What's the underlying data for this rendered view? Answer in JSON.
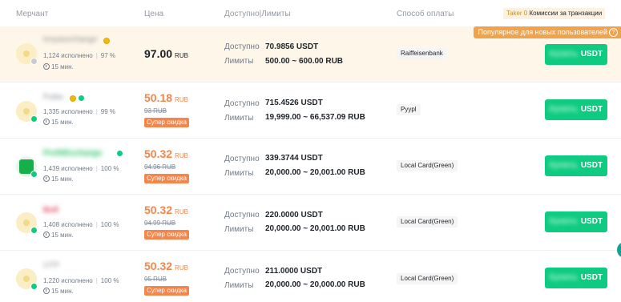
{
  "header": {
    "merchant": "Мерчант",
    "price": "Цена",
    "limits": "Доступно|Лимиты",
    "payment": "Способ оплаты",
    "taker_prefix": "Taker 0",
    "taker_suffix": "Комиссии за транзакции"
  },
  "popular_label": "Популярное для новых пользователей",
  "popular_help": "?",
  "labels": {
    "available": "Доступно",
    "limits": "Лимиты"
  },
  "rows": [
    {
      "merchant": "lonyasochange",
      "stats": "1,124 исполнено",
      "completion": "97 %",
      "time": "15 мин.",
      "price": "97.00",
      "currency": "RUB",
      "old_price": "",
      "discount": "",
      "available": "70.9856 USDT",
      "limits": "500.00 ~ 600.00 RUB",
      "payment": "Raiffeisenbank",
      "buy_hidden": "Купить",
      "buy_asset": "USDT"
    },
    {
      "merchant": "Pubis",
      "stats": "1,335 исполнено",
      "completion": "99 %",
      "time": "15 мин.",
      "price": "50.18",
      "currency": "RUB",
      "old_price": "93 RUB",
      "discount": "Супер скидка",
      "available": "715.4526 USDT",
      "limits": "19,999.00 ~ 66,537.09 RUB",
      "payment": "Pyypl",
      "buy_hidden": "Купить",
      "buy_asset": "USDT"
    },
    {
      "merchant": "ProfitExchange",
      "stats": "1,439 исполнено",
      "completion": "100 %",
      "time": "15 мин.",
      "price": "50.32",
      "currency": "RUB",
      "old_price": "94.96 RUB",
      "discount": "Супер скидка",
      "available": "339.3744 USDT",
      "limits": "20,000.00 ~ 20,001.00 RUB",
      "payment": "Local Card(Green)",
      "buy_hidden": "Купить",
      "buy_asset": "USDT"
    },
    {
      "merchant": "Bull",
      "stats": "1,408 исполнено",
      "completion": "100 %",
      "time": "15 мин.",
      "price": "50.32",
      "currency": "RUB",
      "old_price": "94.99 RUB",
      "discount": "Супер скидка",
      "available": "220.0000 USDT",
      "limits": "20,000.00 ~ 20,001.00 RUB",
      "payment": "Local Card(Green)",
      "buy_hidden": "Купить",
      "buy_asset": "USDT"
    },
    {
      "merchant": "UTP",
      "stats": "1,220 исполнено",
      "completion": "100 %",
      "time": "15 мин.",
      "price": "50.32",
      "currency": "RUB",
      "old_price": "95 RUB",
      "discount": "Супер скидка",
      "available": "211.0000 USDT",
      "limits": "20,000.00 ~ 20,000.00 RUB",
      "payment": "Local Card(Green)",
      "buy_hidden": "Купить",
      "buy_asset": "USDT"
    }
  ]
}
